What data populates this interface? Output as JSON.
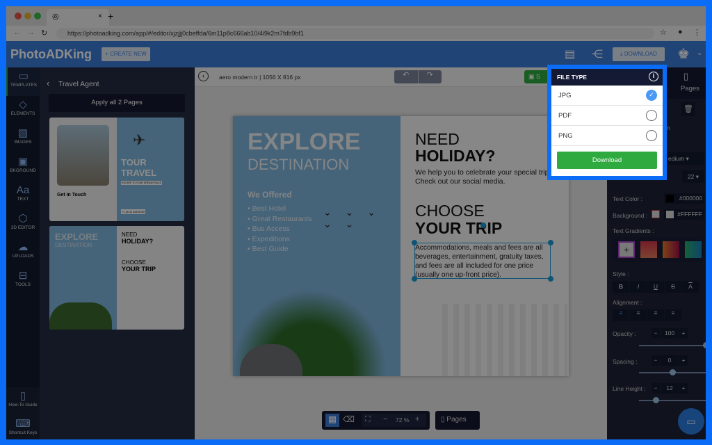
{
  "browser": {
    "url": "https://photoadking.com/app/#/editor/xjzjjj0cbeffda/6m11p8c666ab10/4i9k2m7fdb9bf1",
    "new_tab": "+",
    "close_tab": "×"
  },
  "header": {
    "logo": "PhotoADKing",
    "create_new": "+ CREATE NEW",
    "download": "DOWNLOAD"
  },
  "rail": {
    "items": [
      {
        "label": "TEMPLATES",
        "icon": "layout-icon"
      },
      {
        "label": "ELEMENTS",
        "icon": "shapes-icon"
      },
      {
        "label": "IMAGES",
        "icon": "image-icon"
      },
      {
        "label": "BKGROUND",
        "icon": "background-icon"
      },
      {
        "label": "TEXT",
        "icon": "text-icon"
      },
      {
        "label": "3D EDITOR",
        "icon": "cube-icon"
      },
      {
        "label": "UPLOADS",
        "icon": "upload-icon"
      },
      {
        "label": "TOOLS",
        "icon": "toolbox-icon"
      }
    ],
    "how_to": "How-To Guide",
    "shortcut": "Shortcut Keys"
  },
  "panel": {
    "title": "Travel Agent",
    "apply": "Apply all 2 Pages",
    "thumb1": {
      "title1": "TOUR",
      "title2": "TRAVEL",
      "tag": "ESCAPE TO YOUR DREAM PLACE",
      "contact": "Get In Touch",
      "phone": "+1 (012) 345 6789"
    },
    "thumb2": {
      "t1": "EXPLORE",
      "t2": "DESTINATION",
      "need": "NEED",
      "holiday": "HOLIDAY?",
      "choose": "CHOOSE",
      "trip": "YOUR TRIP"
    }
  },
  "toolbar": {
    "doc": "aero modern tr | 1056 X 816 px",
    "save": "S"
  },
  "design": {
    "explore": "EXPLORE",
    "destination": "DESTINATION",
    "offered": "We Offered",
    "list": [
      "• Best Hotel",
      "• Great Restaurants",
      "• Bus Access",
      "• Expeditions",
      "• Best Guide"
    ],
    "need": "NEED",
    "holiday": "HOLIDAY?",
    "help": "We help you to celebrate your special trips Check out our social media.",
    "choose": "CHOOSE",
    "trip": "YOUR TRIP",
    "body": "Accommodations, meals and fees are all beverages, entertainment, gratuity taxes, and fees are all included for one price (usually one up-front price)."
  },
  "popup": {
    "title": "FILE TYPE",
    "options": [
      {
        "label": "JPG",
        "selected": true
      },
      {
        "label": "PDF",
        "selected": false
      },
      {
        "label": "PNG",
        "selected": false
      }
    ],
    "download": "Download"
  },
  "right": {
    "pages": "Pages",
    "font_weight": "edium",
    "font_size": "22",
    "cut_text": "n",
    "text_color_label": "Text Color :",
    "text_color": "#000000",
    "background_label": "Background :",
    "background": "#FFFFFF",
    "gradients_label": "Text Gradients :",
    "style_label": "Style :",
    "style": [
      "B",
      "I",
      "U",
      "S",
      "A"
    ],
    "alignment_label": "Alignment :",
    "opacity_label": "Opacity :",
    "opacity": "100",
    "spacing_label": "Spacing :",
    "spacing": "0",
    "lineheight_label": "Line Height :",
    "lineheight": "12"
  },
  "bottom": {
    "zoom": "72 %",
    "pages": "Pages"
  }
}
